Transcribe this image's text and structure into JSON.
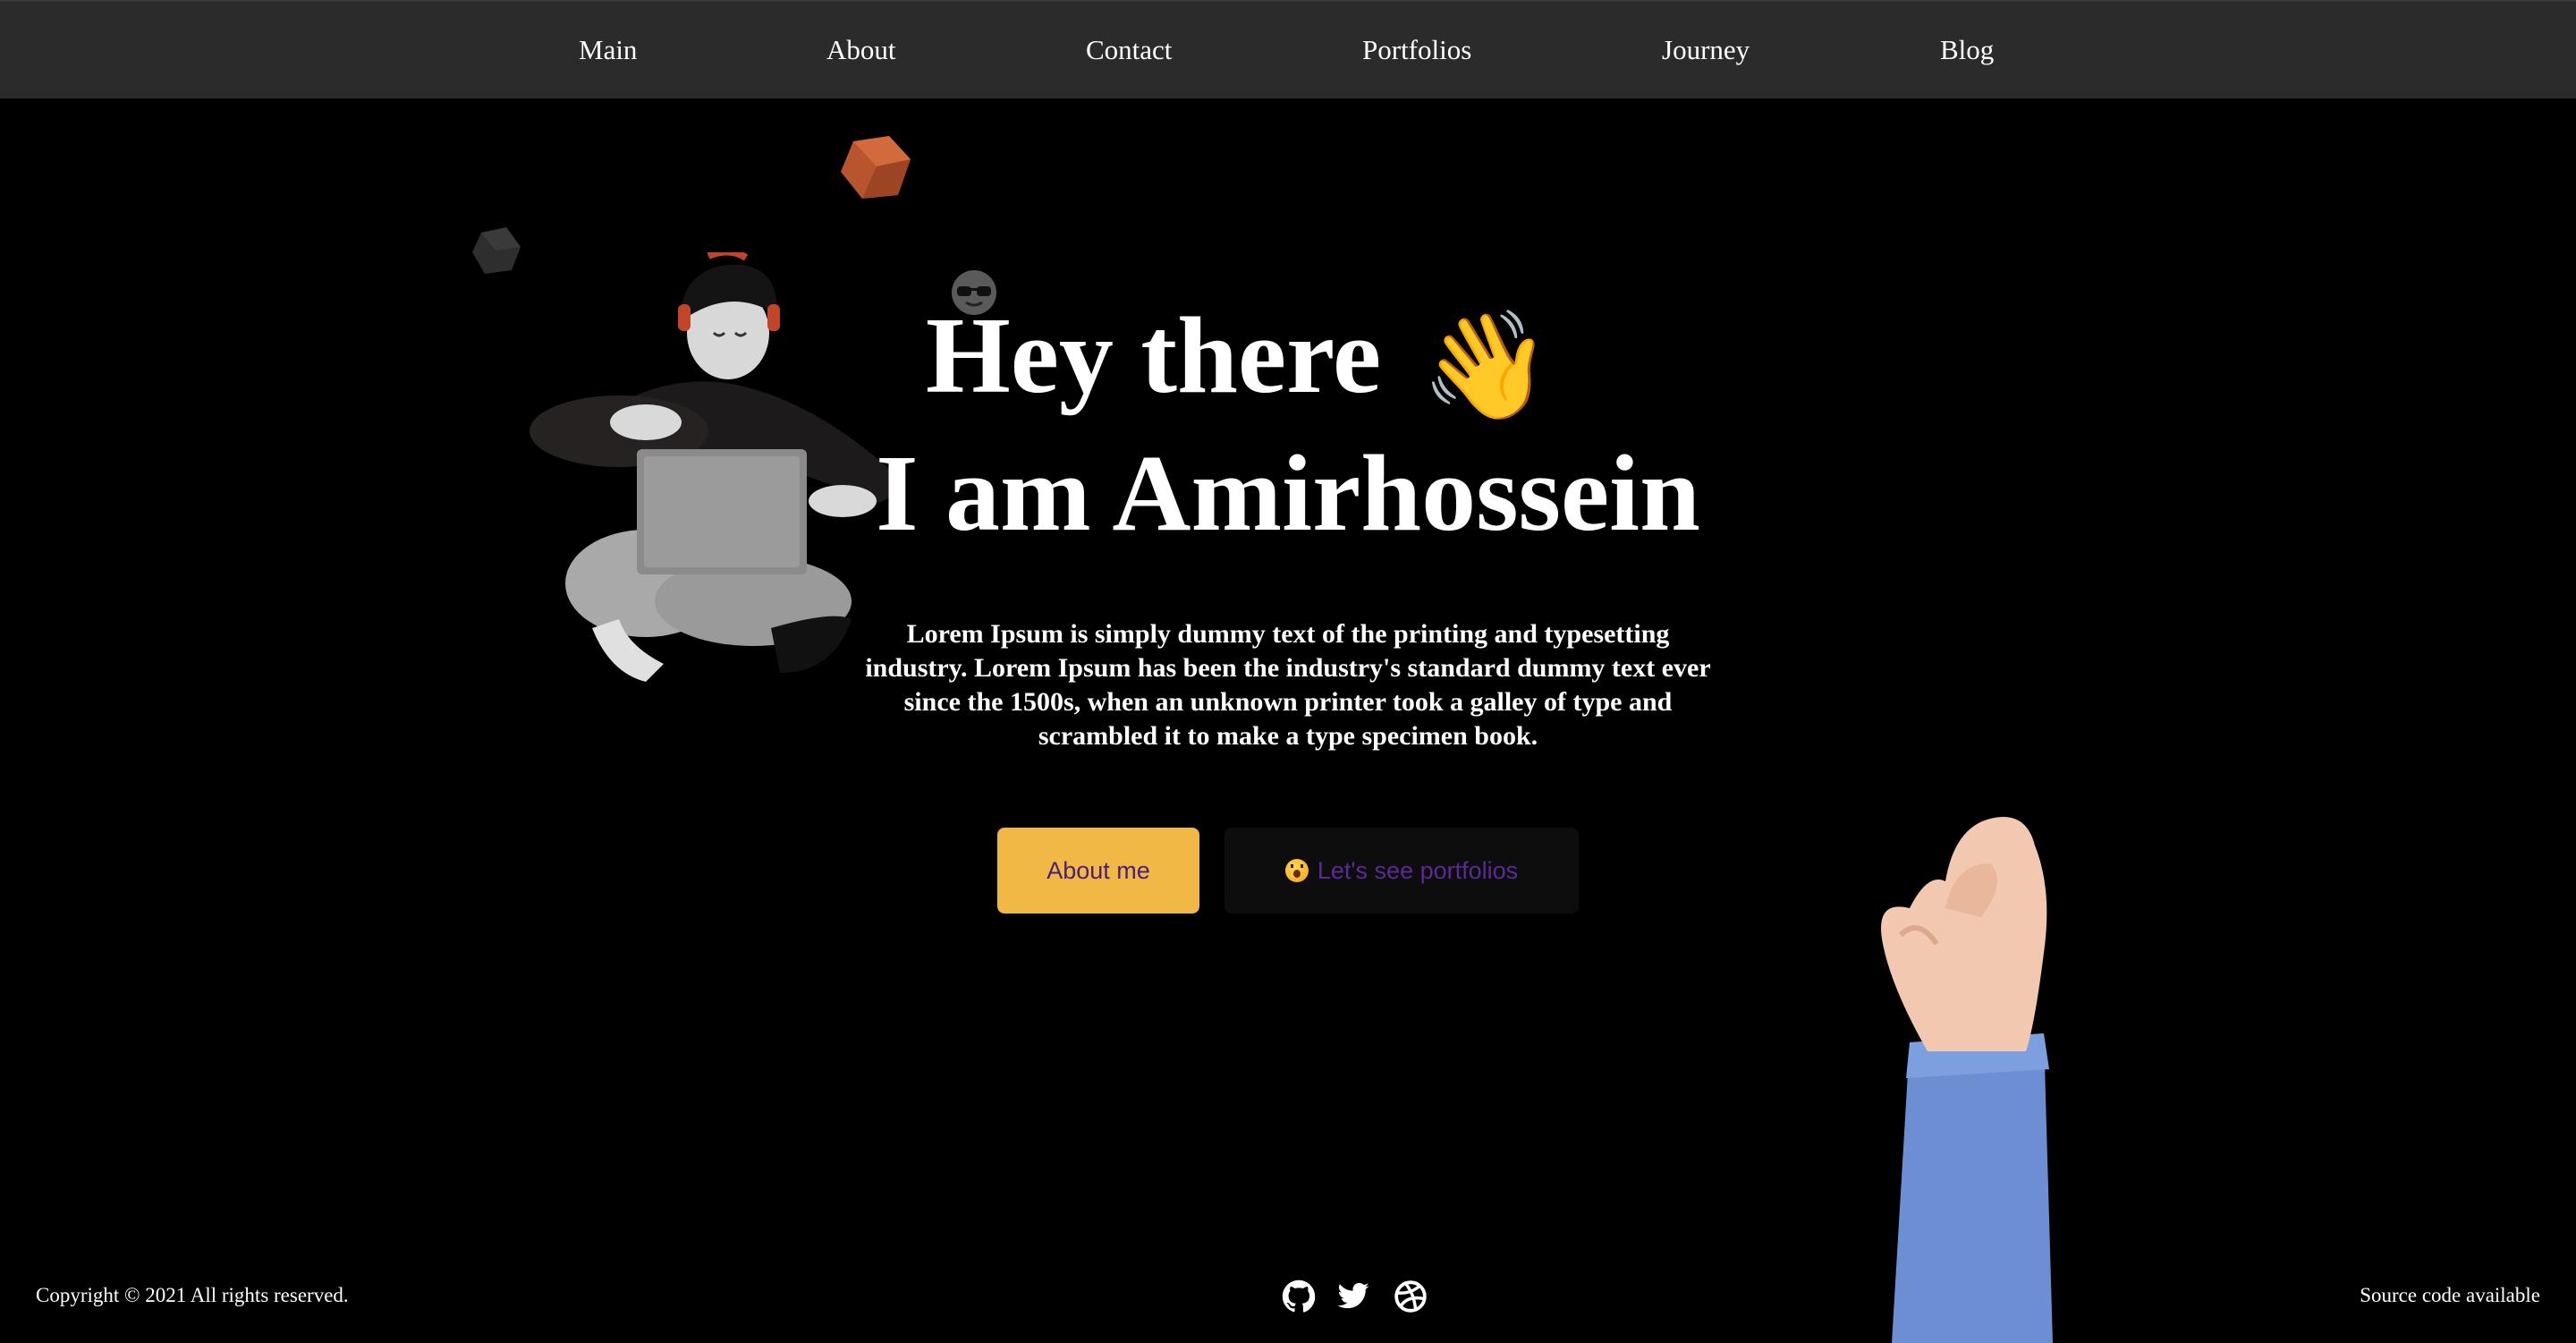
{
  "nav": {
    "items": [
      {
        "label": "Main"
      },
      {
        "label": "About"
      },
      {
        "label": "Contact"
      },
      {
        "label": "Portfolios"
      },
      {
        "label": "Journey"
      },
      {
        "label": "Blog"
      }
    ]
  },
  "hero": {
    "greeting": "Hey there",
    "wave_emoji": "👋",
    "name_line": "I am Amirhossein",
    "description": "Lorem Ipsum is simply dummy text of the printing and typesetting industry. Lorem Ipsum has been the industry's standard dummy text ever since the 1500s, when an unknown printer took a galley of type and scrambled it to make a type specimen book.",
    "about_button": "About me",
    "portfolio_button": "Let's see portfolios"
  },
  "footer": {
    "copyright": "Copyright © 2021 All rights reserved.",
    "source": "Source code available",
    "social_icons": [
      "github-icon",
      "twitter-icon",
      "dribbble-icon"
    ]
  },
  "colors": {
    "background": "#000000",
    "navbar": "#2b2b2b",
    "accent_button": "#f2b845",
    "button_text": "#4a1e7a",
    "secondary_button": "#0d0d0d"
  }
}
